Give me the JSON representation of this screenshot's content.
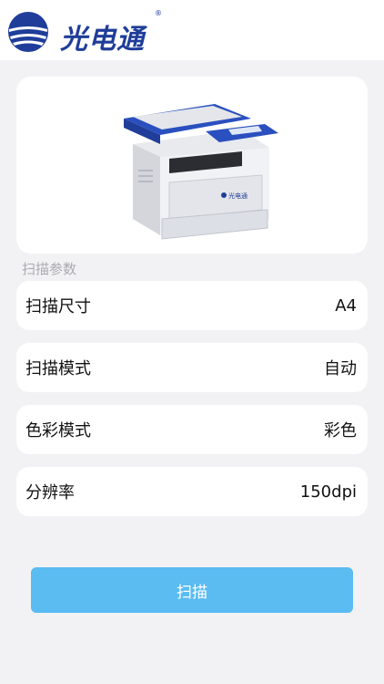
{
  "header": {
    "brand_name": "光电通",
    "registered_mark": "®",
    "logo_icon": "brand-globe-icon"
  },
  "printer_card": {
    "image": "multifunction-printer-image",
    "device_brand_mark": "光电通"
  },
  "section": {
    "label": "扫描参数"
  },
  "params": [
    {
      "label": "扫描尺寸",
      "value": "A4"
    },
    {
      "label": "扫描模式",
      "value": "自动"
    },
    {
      "label": "色彩模式",
      "value": "彩色"
    },
    {
      "label": "分辨率",
      "value": "150dpi"
    }
  ],
  "actions": {
    "scan_label": "扫描"
  },
  "colors": {
    "brand_blue": "#1f3d99",
    "button_blue": "#5bbcf2",
    "background": "#f2f2f4"
  }
}
